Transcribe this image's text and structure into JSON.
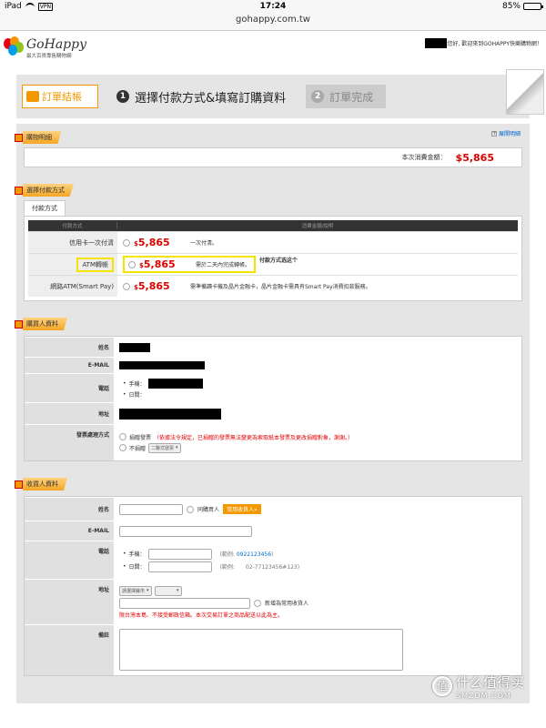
{
  "status": {
    "device": "iPad",
    "vpn": "VPN",
    "time": "17:24",
    "battery": "85%",
    "battery_level": 0.85
  },
  "url": "gohappy.com.tw",
  "header": {
    "logo_name": "GoHappy",
    "logo_sub": "最大百貨專售購物網",
    "welcome": "您好, 歡迎來到GOHAPPY快樂購物網！"
  },
  "steps": [
    {
      "label": "訂單結帳"
    },
    {
      "num": "1",
      "label": "選擇付款方式&填寫訂購資料"
    },
    {
      "num": "2",
      "label": "訂單完成"
    }
  ],
  "cart": {
    "title": "購物明細",
    "expand_label": "展開明細",
    "total_label": "本次消費金額：",
    "total_value": "$5,865"
  },
  "payment": {
    "title": "選擇付款方式",
    "tab": "付款方式",
    "col1": "付款方式",
    "col2": "消費金額/說明",
    "rows": [
      {
        "method": "信用卡一次付清",
        "currency": "$",
        "amount": "5,865",
        "desc": "一次付清。"
      },
      {
        "method": "ATM轉帳",
        "currency": "$",
        "amount": "5,865",
        "desc": "需於二天內完成轉帳。",
        "note": "付款方式选这个"
      },
      {
        "method": "網路ATM(Smart Pay)",
        "currency": "$",
        "amount": "5,865",
        "desc": "需準備讀卡機及晶片金融卡，晶片金融卡需具有Smart Pay消費扣款服務。"
      }
    ]
  },
  "buyer": {
    "title": "購買人資料",
    "name_label": "姓名",
    "email_label": "E-MAIL",
    "phone_label": "電話",
    "mobile_label": "手機：",
    "day_label": "日間：",
    "address_label": "地址",
    "invoice_label": "發票處理方式",
    "donate_label": "捐贈發票",
    "donate_note": "（依據法令規定，已捐贈的發票無法變更為索取紙本發票及更改捐贈對象，謝謝。）",
    "no_donate_label": "不捐贈",
    "invoice_select": "二聯式發票"
  },
  "recipient": {
    "title": "收貨人資料",
    "name_label": "姓名",
    "same_as_buyer": "同購買人",
    "common_btn": "常用收貨人»",
    "email_label": "E-MAIL",
    "phone_label": "電話",
    "mobile_label": "手機：",
    "mobile_example": "(範例: ",
    "mobile_example_value": "0922123456",
    "mobile_example_end": ")",
    "day_label": "日間：",
    "day_example": "(範例:　　02-77123456#123)",
    "address_label": "地址",
    "city_select": "請選擇縣市",
    "save_common": "新增為常用收貨人",
    "address_note": "限台灣本島、不接受郵政信箱。本次交易訂單之商品配送以此為主。",
    "remark_label": "備註"
  },
  "watermark": {
    "icon": "值",
    "line1": "什么值得买",
    "line2": "SMZDM.COM"
  }
}
